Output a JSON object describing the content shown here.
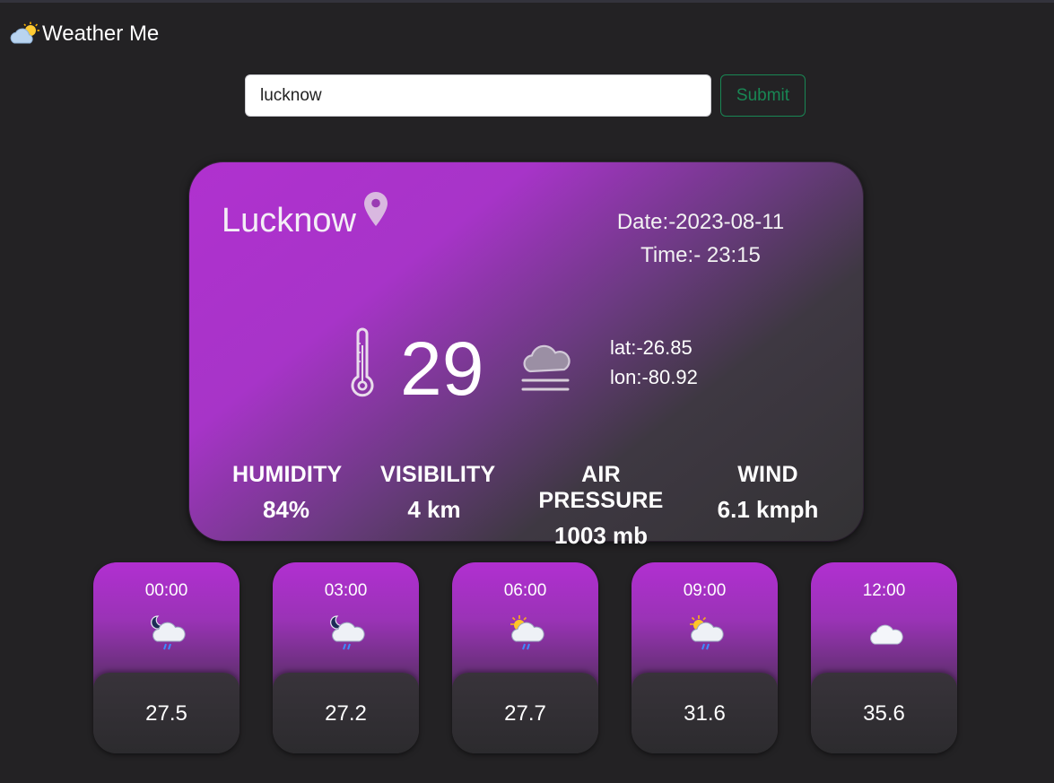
{
  "header": {
    "title": "Weather Me",
    "icon": "sun-behind-cloud-icon"
  },
  "search": {
    "value": "lucknow",
    "submit_label": "Submit"
  },
  "current": {
    "city": "Lucknow",
    "date": "Date:-2023-08-11",
    "time": "Time:- 23:15",
    "temperature": "29",
    "lat": "lat:-26.85",
    "lon": "lon:-80.92",
    "condition_icon": "fog-cloud-icon",
    "stats": [
      {
        "label": "HUMIDITY",
        "value": "84%"
      },
      {
        "label": "VISIBILITY",
        "value": "4 km"
      },
      {
        "label": "AIR PRESSURE",
        "value": "1003 mb"
      },
      {
        "label": "WIND",
        "value": "6.1 kmph"
      }
    ]
  },
  "forecast": [
    {
      "time": "00:00",
      "temp": "27.5",
      "icon": "night-rain-icon"
    },
    {
      "time": "03:00",
      "temp": "27.2",
      "icon": "night-rain-icon"
    },
    {
      "time": "06:00",
      "temp": "27.7",
      "icon": "sun-rain-icon"
    },
    {
      "time": "09:00",
      "temp": "31.6",
      "icon": "sun-rain-icon"
    },
    {
      "time": "12:00",
      "temp": "35.6",
      "icon": "cloud-icon"
    }
  ],
  "colors": {
    "background": "#232224",
    "card_purple": "#b031cf",
    "submit_green": "#198754"
  }
}
